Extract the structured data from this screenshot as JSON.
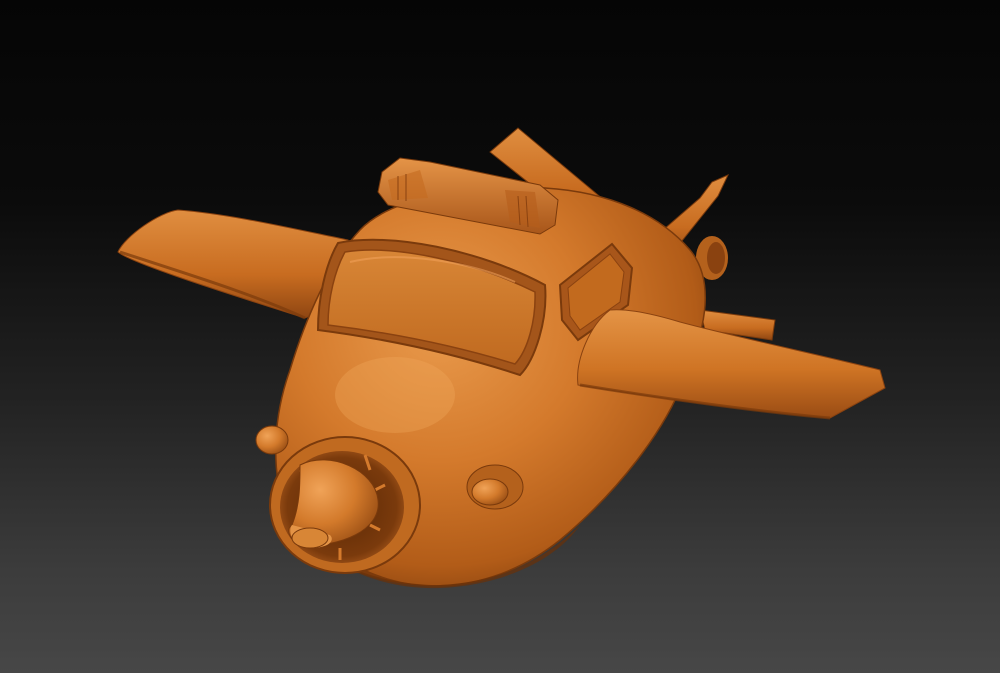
{
  "scene": {
    "subject": "cartoon-airplane-sculpt",
    "colors": {
      "background_top": "#050505",
      "background_bottom": "#474747",
      "material_light": "#e08a3c",
      "material_mid": "#c96c1f",
      "material_dark": "#8a4210",
      "material_shadow": "#5a2806"
    }
  }
}
